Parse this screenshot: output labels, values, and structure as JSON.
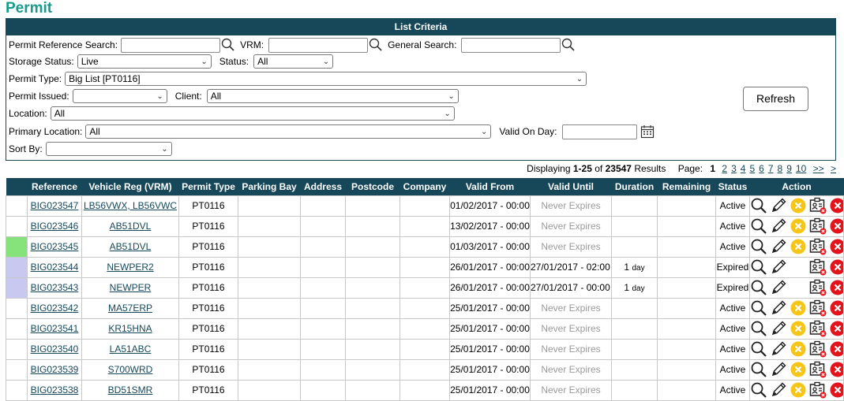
{
  "page": {
    "title": "Permit"
  },
  "criteria": {
    "header": "List Criteria",
    "permit_ref_label": "Permit Reference Search:",
    "vrm_label": "VRM:",
    "general_label": "General Search:",
    "storage_label": "Storage Status:",
    "storage_value": "Live",
    "status_label": "Status:",
    "status_value": "All",
    "permit_type_label": "Permit Type:",
    "permit_type_value": "Big List [PT0116]",
    "permit_issued_label": "Permit Issued:",
    "permit_issued_value": "",
    "client_label": "Client:",
    "client_value": "All",
    "location_label": "Location:",
    "location_value": "All",
    "primary_location_label": "Primary Location:",
    "primary_location_value": "All",
    "valid_on_day_label": "Valid On Day:",
    "sort_by_label": "Sort By:",
    "sort_by_value": "",
    "refresh_label": "Refresh"
  },
  "summary": {
    "displaying": "Displaying",
    "range": "1-25",
    "of": "of",
    "total": "23547",
    "results": "Results",
    "page_label": "Page:",
    "current_page": "1",
    "pages": [
      "2",
      "3",
      "4",
      "5",
      "6",
      "7",
      "8",
      "9",
      "10"
    ],
    "next": ">>",
    "last": ">"
  },
  "table": {
    "columns": [
      "Reference",
      "Vehicle Reg (VRM)",
      "Permit Type",
      "Parking Bay",
      "Address",
      "Postcode",
      "Company",
      "Valid From",
      "Valid Until",
      "Duration",
      "Remaining",
      "Status",
      "Action"
    ],
    "rows": [
      {
        "marker": "",
        "ref": "BIG023547",
        "vrm": "LB56VWX, LB56VWC",
        "type": "PT0116",
        "bay": "",
        "address": "",
        "postcode": "",
        "company": "",
        "from": "01/02/2017 - 00:00",
        "until": "Never Expires",
        "duration": "",
        "duration_unit": "",
        "remaining": "",
        "status": "Active"
      },
      {
        "marker": "",
        "ref": "BIG023546",
        "vrm": "AB51DVL",
        "type": "PT0116",
        "bay": "",
        "address": "",
        "postcode": "",
        "company": "",
        "from": "13/02/2017 - 00:00",
        "until": "Never Expires",
        "duration": "",
        "duration_unit": "",
        "remaining": "",
        "status": "Active"
      },
      {
        "marker": "green",
        "ref": "BIG023545",
        "vrm": "AB51DVL",
        "type": "PT0116",
        "bay": "",
        "address": "",
        "postcode": "",
        "company": "",
        "from": "01/03/2017 - 00:00",
        "until": "Never Expires",
        "duration": "",
        "duration_unit": "",
        "remaining": "",
        "status": "Active"
      },
      {
        "marker": "lavender",
        "ref": "BIG023544",
        "vrm": "NEWPER2",
        "type": "PT0116",
        "bay": "",
        "address": "",
        "postcode": "",
        "company": "",
        "from": "26/01/2017 - 00:00",
        "until": "27/01/2017 - 02:00",
        "duration": "1",
        "duration_unit": "day",
        "remaining": "",
        "status": "Expired"
      },
      {
        "marker": "lavender",
        "ref": "BIG023543",
        "vrm": "NEWPER",
        "type": "PT0116",
        "bay": "",
        "address": "",
        "postcode": "",
        "company": "",
        "from": "26/01/2017 - 00:00",
        "until": "27/01/2017 - 00:00",
        "duration": "1",
        "duration_unit": "day",
        "remaining": "",
        "status": "Expired"
      },
      {
        "marker": "",
        "ref": "BIG023542",
        "vrm": "MA57ERP",
        "type": "PT0116",
        "bay": "",
        "address": "",
        "postcode": "",
        "company": "",
        "from": "25/01/2017 - 00:00",
        "until": "Never Expires",
        "duration": "",
        "duration_unit": "",
        "remaining": "",
        "status": "Active"
      },
      {
        "marker": "",
        "ref": "BIG023541",
        "vrm": "KR15HNA",
        "type": "PT0116",
        "bay": "",
        "address": "",
        "postcode": "",
        "company": "",
        "from": "25/01/2017 - 00:00",
        "until": "Never Expires",
        "duration": "",
        "duration_unit": "",
        "remaining": "",
        "status": "Active"
      },
      {
        "marker": "",
        "ref": "BIG023540",
        "vrm": "LA51ABC",
        "type": "PT0116",
        "bay": "",
        "address": "",
        "postcode": "",
        "company": "",
        "from": "25/01/2017 - 00:00",
        "until": "Never Expires",
        "duration": "",
        "duration_unit": "",
        "remaining": "",
        "status": "Active"
      },
      {
        "marker": "",
        "ref": "BIG023539",
        "vrm": "S700WRD",
        "type": "PT0116",
        "bay": "",
        "address": "",
        "postcode": "",
        "company": "",
        "from": "25/01/2017 - 00:00",
        "until": "Never Expires",
        "duration": "",
        "duration_unit": "",
        "remaining": "",
        "status": "Active"
      },
      {
        "marker": "",
        "ref": "BIG023538",
        "vrm": "BD51SMR",
        "type": "PT0116",
        "bay": "",
        "address": "",
        "postcode": "",
        "company": "",
        "from": "25/01/2017 - 00:00",
        "until": "Never Expires",
        "duration": "",
        "duration_unit": "",
        "remaining": "",
        "status": "Active"
      }
    ]
  },
  "colors": {
    "brand": "#16485a",
    "title": "#1a9a8a",
    "marker_green": "#86e27a",
    "marker_lavender": "#c9c8f0",
    "cancel_yellow": "#f5c518",
    "delete_red": "#e3141c"
  },
  "icons": {
    "search": "magnifier-icon",
    "calendar": "calendar-icon",
    "view": "view-icon",
    "edit": "pencil-icon",
    "cancel": "cancel-permit-icon",
    "card": "permit-card-icon",
    "delete": "delete-icon"
  }
}
